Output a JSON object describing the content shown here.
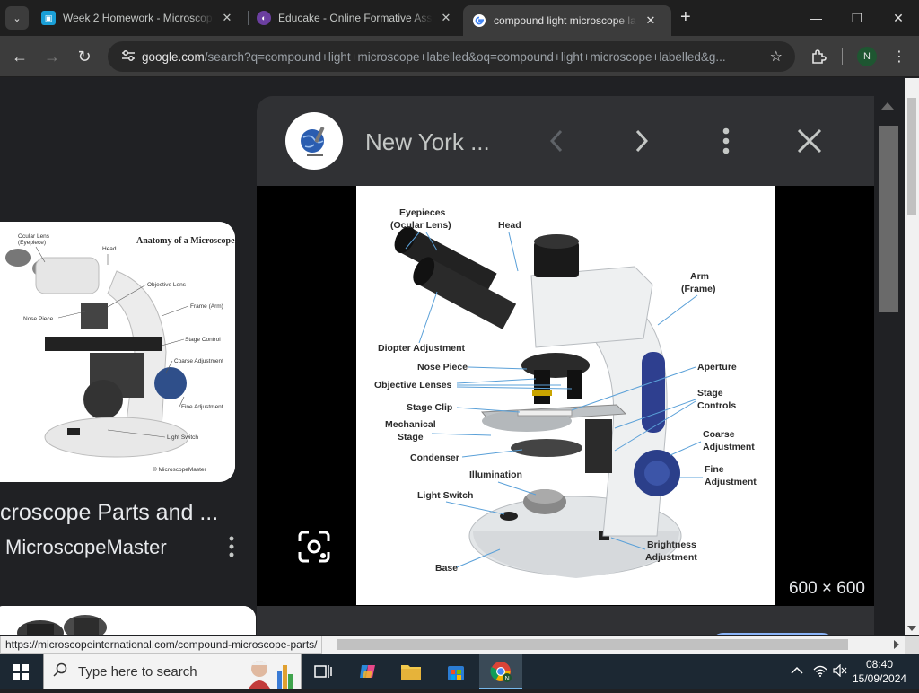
{
  "browser": {
    "tabs": [
      {
        "title": "Week 2 Homework - Microscop",
        "close": "✕",
        "favicon_color": "#1a9fd7"
      },
      {
        "title": "Educake - Online Formative Ass",
        "close": "✕",
        "favicon_color": "#6b3fa0"
      },
      {
        "title": "compound light microscope lab",
        "close": "✕",
        "active": true
      }
    ],
    "new_tab": "+",
    "window_controls": {
      "minimize": "—",
      "restore": "❐",
      "close": "✕"
    },
    "toolbar": {
      "back": "←",
      "forward": "→",
      "reload": "↻",
      "url_domain": "google.com",
      "url_path": "/search?q=compound+light+microscope+labelled&oq=compound+light+microscope+labelled&g...",
      "profile_initial": "N"
    }
  },
  "results": {
    "left_card": {
      "title": "croscope Parts and ...",
      "source": "MicroscopeMaster",
      "more": "⋮",
      "image": {
        "heading": "Anatomy of a Microscope",
        "labels": [
          "Ocular Lens (Eyepiece)",
          "Head",
          "Objective Lens",
          "Frame (Arm)",
          "Nose Piece",
          "Stage Control",
          "Coarse Adjustment",
          "Fine Adjustment",
          "Light Switch",
          "MicroscopeMaster.com"
        ]
      }
    }
  },
  "viewer": {
    "site_name": "New York ...",
    "prev": "‹",
    "next": "›",
    "more": "⋮",
    "close": "✕",
    "image_dimensions": "600 × 600",
    "diagram_labels": {
      "eyepieces": "Eyepieces",
      "ocular_lens": "(Ocular Lens)",
      "head": "Head",
      "arm": "Arm",
      "frame": "(Frame)",
      "diopter": "Diopter Adjustment",
      "nose_piece": "Nose Piece",
      "objective_lenses": "Objective Lenses",
      "stage_clip": "Stage Clip",
      "mechanical": "Mechanical",
      "stage": "Stage",
      "condenser": "Condenser",
      "illumination": "Illumination",
      "light_switch": "Light Switch",
      "base": "Base",
      "aperture": "Aperture",
      "stage_controls_1": "Stage",
      "stage_controls_2": "Controls",
      "coarse_1": "Coarse",
      "coarse_2": "Adjustment",
      "fine_1": "Fine",
      "fine_2": "Adjustment",
      "brightness_1": "Brightness",
      "brightness_2": "Adjustment"
    }
  },
  "status_bar": {
    "url": "https://microscopeinternational.com/compound-microscope-parts/"
  },
  "taskbar": {
    "search_placeholder": "Type here to search",
    "time": "08:40",
    "date": "15/09/2024",
    "tray_chevron": "^"
  },
  "colors": {
    "browser_dark": "#1f1f1f",
    "toolbar": "#3c3c3c",
    "panel": "#303134",
    "accent_blue": "#8ab4f8",
    "taskbar": "#1c2833"
  }
}
